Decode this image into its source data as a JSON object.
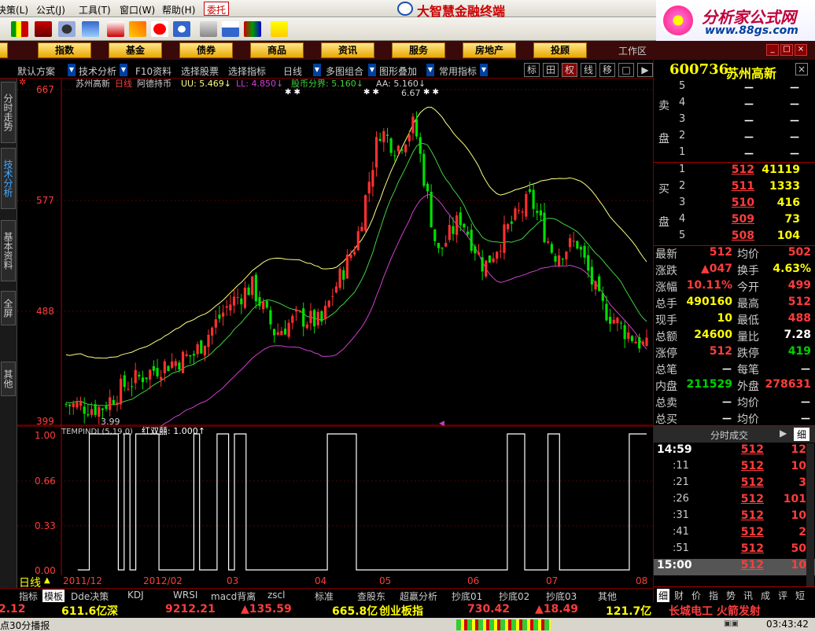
{
  "menu": {
    "items": [
      "决策(L)",
      "公式(J)",
      "工具(T)",
      "窗口(W)",
      "帮助(H)"
    ],
    "entrust": "委托",
    "brand": "大智慧金融终端"
  },
  "watermark": {
    "title": "分析家公式网",
    "url": "www.88gs.com"
  },
  "catbar": {
    "items": [
      "股",
      "指数",
      "基金",
      "债券",
      "商品",
      "资讯",
      "服务",
      "房地产",
      "投顾"
    ],
    "workarea": "工作区",
    "win_buttons": [
      "_",
      "□",
      "×"
    ]
  },
  "subbar": {
    "items": [
      "默认方案",
      "技术分析",
      "F10资料",
      "选择股票",
      "选择指标",
      "日线",
      "多图组合",
      "图形叠加",
      "常用指标"
    ],
    "toggles": [
      "标",
      "田",
      "权",
      "线",
      "移",
      "□",
      "▶"
    ]
  },
  "sidebar": {
    "tabs": [
      "分时走势",
      "技术分析",
      "基本资料",
      "全屏",
      "其他"
    ]
  },
  "main_chart": {
    "header": {
      "name": "苏州高新",
      "period": "日线",
      "indicator": "阿德持币",
      "uu_label": "UU: 5.469↓",
      "ll_label": "LL: 4.850↓",
      "bound_label": "股币分界: 5.160↓",
      "aa_label": "AA: 5.160↓"
    },
    "y_labels": [
      "667",
      "577",
      "488",
      "399"
    ],
    "high_label": "6.67",
    "low_label": "3.99",
    "colors": {
      "up": "#ff3030",
      "down": "#00e000",
      "uu": "#ffff80",
      "ll": "#d040d0",
      "aa": "#40d040"
    }
  },
  "indicator_chart": {
    "header": "TEMPINDI (5,19,0)",
    "series_label": "红双囍: 1.000↑",
    "y_labels": [
      "1.00",
      "0.66",
      "0.33",
      "0.00"
    ]
  },
  "period_axis": {
    "label": "日线",
    "dates": [
      "2011/12",
      "2012/02",
      "03",
      "04",
      "05",
      "06",
      "07",
      "08"
    ]
  },
  "bottom_tabs": [
    "指标",
    "模板",
    "Dde决策",
    "KDJ",
    "WRSI",
    "macd背离",
    "zscl",
    "标准",
    "查股东",
    "超赢分析",
    "抄底01",
    "抄底02",
    "抄底03",
    "其他"
  ],
  "ticker": {
    "items": [
      {
        "t": "2.12",
        "c": "#ff3c3c"
      },
      {
        "t": "611.6亿",
        "c": "#ff0"
      },
      {
        "t": "深",
        "c": "#ff0"
      },
      {
        "t": "9212.21",
        "c": "#ff3c3c"
      },
      {
        "t": "▲135.59",
        "c": "#ff3c3c"
      },
      {
        "t": "665.8亿",
        "c": "#ff0"
      },
      {
        "t": "创业板指",
        "c": "#ff0"
      },
      {
        "t": "730.42",
        "c": "#ff3c3c"
      },
      {
        "t": "▲18.49",
        "c": "#ff3c3c"
      },
      {
        "t": "121.7亿",
        "c": "#ff0"
      },
      {
        "t": "长城电工 火箭发射",
        "c": "#ff3c3c"
      }
    ]
  },
  "status": {
    "left": "点30分播报",
    "time": "03:43:42"
  },
  "quote": {
    "code": "600736",
    "name": "苏州高新",
    "sell": [
      {
        "lvl": "5",
        "px": "－",
        "vol": "－"
      },
      {
        "lvl": "4",
        "px": "－",
        "vol": "－"
      },
      {
        "lvl": "3",
        "px": "－",
        "vol": "－"
      },
      {
        "lvl": "2",
        "px": "－",
        "vol": "－"
      },
      {
        "lvl": "1",
        "px": "－",
        "vol": "－"
      }
    ],
    "sell_label": [
      "卖",
      "盘"
    ],
    "buy": [
      {
        "lvl": "1",
        "px": "512",
        "vol": "41119"
      },
      {
        "lvl": "2",
        "px": "511",
        "vol": "1333"
      },
      {
        "lvl": "3",
        "px": "510",
        "vol": "416"
      },
      {
        "lvl": "4",
        "px": "509",
        "vol": "73"
      },
      {
        "lvl": "5",
        "px": "508",
        "vol": "104"
      }
    ],
    "buy_label": [
      "买",
      "盘"
    ],
    "stats": [
      {
        "l1": "最新",
        "v1": "512",
        "c1": "red",
        "l2": "均价",
        "v2": "502",
        "c2": "red"
      },
      {
        "l1": "涨跌",
        "v1": "▲047",
        "c1": "red",
        "l2": "换手",
        "v2": "4.63%",
        "c2": "yel"
      },
      {
        "l1": "涨幅",
        "v1": "10.11%",
        "c1": "red",
        "l2": "今开",
        "v2": "499",
        "c2": "red"
      },
      {
        "l1": "总手",
        "v1": "490160",
        "c1": "yel",
        "l2": "最高",
        "v2": "512",
        "c2": "red"
      },
      {
        "l1": "现手",
        "v1": "10",
        "c1": "yel",
        "l2": "最低",
        "v2": "488",
        "c2": "red"
      },
      {
        "l1": "总额",
        "v1": "24600",
        "c1": "yel",
        "l2": "量比",
        "v2": "7.28",
        "c2": "wht"
      },
      {
        "l1": "涨停",
        "v1": "512",
        "c1": "red",
        "l2": "跌停",
        "v2": "419",
        "c2": "grn"
      },
      {
        "l1": "总笔",
        "v1": "－",
        "c1": "wht",
        "l2": "每笔",
        "v2": "－",
        "c2": "wht"
      },
      {
        "l1": "内盘",
        "v1": "211529",
        "c1": "grn",
        "l2": "外盘",
        "v2": "278631",
        "c2": "red"
      },
      {
        "l1": "总卖",
        "v1": "－",
        "c1": "wht",
        "l2": "均价",
        "v2": "－",
        "c2": "wht"
      },
      {
        "l1": "总买",
        "v1": "－",
        "c1": "wht",
        "l2": "均价",
        "v2": "－",
        "c2": "wht"
      }
    ],
    "trades_title": "分时成交",
    "trades_btn": "细",
    "trades": [
      {
        "t": "14:59",
        "p": "512",
        "v": "12"
      },
      {
        "t": ":11",
        "p": "512",
        "v": "10"
      },
      {
        "t": ":21",
        "p": "512",
        "v": "3"
      },
      {
        "t": ":26",
        "p": "512",
        "v": "101"
      },
      {
        "t": ":31",
        "p": "512",
        "v": "10"
      },
      {
        "t": ":41",
        "p": "512",
        "v": "2"
      },
      {
        "t": ":51",
        "p": "512",
        "v": "50"
      },
      {
        "t": "15:00",
        "p": "512",
        "v": "10"
      }
    ],
    "tabs": [
      "细",
      "财",
      "价",
      "指",
      "势",
      "讯",
      "成",
      "评",
      "短"
    ]
  }
}
